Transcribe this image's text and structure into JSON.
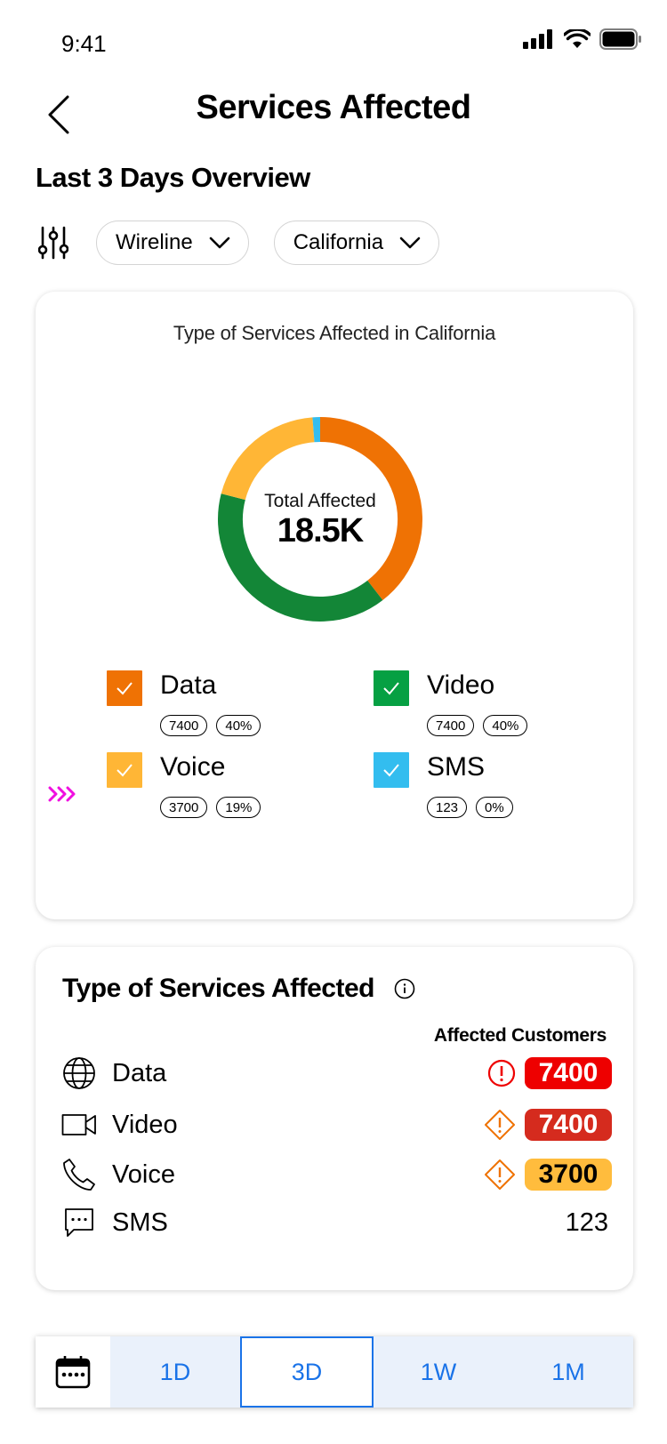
{
  "status": {
    "time": "9:41"
  },
  "header": {
    "title": "Services Affected"
  },
  "overview": {
    "title": "Last 3 Days Overview"
  },
  "filters": {
    "network": "Wireline",
    "region": "California"
  },
  "chart_data": {
    "type": "pie",
    "title": "Type of Services Affected in California",
    "center_label": "Total Affected",
    "center_value": "18.5K",
    "series": [
      {
        "name": "Data",
        "value": 7400,
        "percent": "40%",
        "color": "#EF7204"
      },
      {
        "name": "Video",
        "value": 7400,
        "percent": "40%",
        "color": "#138637"
      },
      {
        "name": "Voice",
        "value": 3700,
        "percent": "19%",
        "color": "#FFB636"
      },
      {
        "name": "SMS",
        "value": 123,
        "percent": "0%",
        "color": "#33BDEF"
      }
    ]
  },
  "legend": [
    {
      "name": "Data",
      "count": "7400",
      "percent": "40%",
      "color": "#EF7204"
    },
    {
      "name": "Video",
      "count": "7400",
      "percent": "40%",
      "color": "#06A043"
    },
    {
      "name": "Voice",
      "count": "3700",
      "percent": "19%",
      "color": "#FFB636"
    },
    {
      "name": "SMS",
      "count": "123",
      "percent": "0%",
      "color": "#33BDEF"
    }
  ],
  "services_table": {
    "title": "Type of Services Affected",
    "column_header": "Affected Customers",
    "rows": [
      {
        "label": "Data",
        "value": "7400",
        "icon": "globe-icon",
        "alert": "error-icon",
        "badge_color": "#EE0000",
        "text_color": "#ffffff"
      },
      {
        "label": "Video",
        "value": "7400",
        "icon": "video-camera-icon",
        "alert": "warning-icon",
        "badge_color": "#D52B1E",
        "text_color": "#ffffff"
      },
      {
        "label": "Voice",
        "value": "3700",
        "icon": "phone-icon",
        "alert": "warning-icon",
        "badge_color": "#FFBC3D",
        "text_color": "#000000"
      },
      {
        "label": "SMS",
        "value": "123",
        "icon": "message-icon",
        "alert": "",
        "badge_color": "",
        "text_color": "#000000"
      }
    ]
  },
  "time_range": {
    "options": [
      "1D",
      "3D",
      "1W",
      "1M"
    ],
    "selected": "3D",
    "accent": "#1A73E8"
  }
}
